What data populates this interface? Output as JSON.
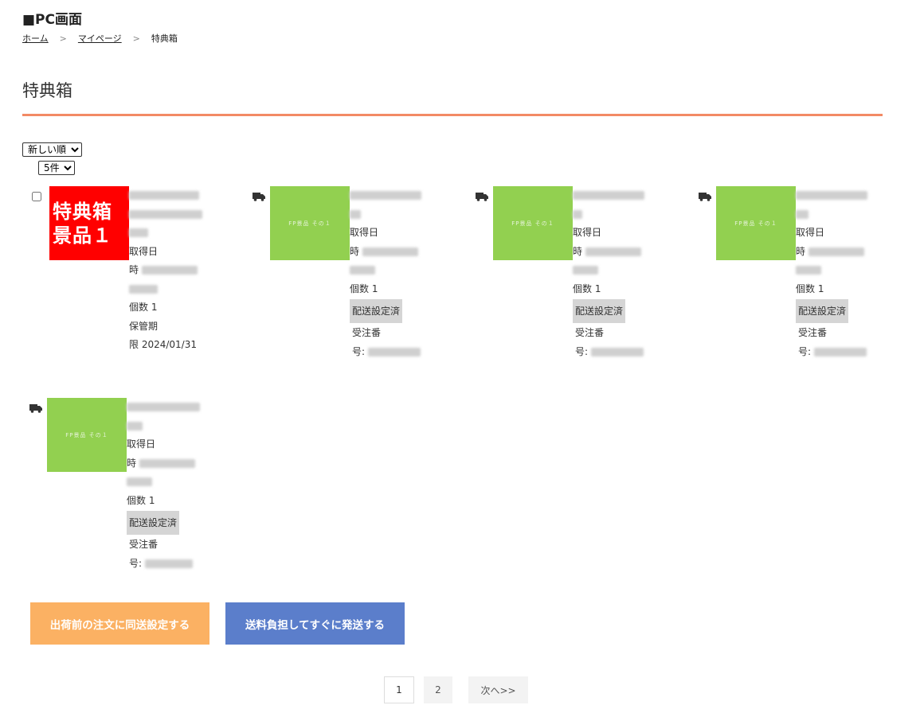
{
  "header": {
    "screen_label": "■PC画面"
  },
  "breadcrumb": {
    "home": "ホーム",
    "mypage": "マイページ",
    "current": "特典箱",
    "separator": ">"
  },
  "page": {
    "title": "特典箱"
  },
  "controls": {
    "sort_selected": "新しい順",
    "count_selected": "5件"
  },
  "items": [
    {
      "thumb_line1": "特典箱",
      "thumb_line2": "景品１",
      "date_label_a": "取得日",
      "date_label_b": "時",
      "qty": "個数 1",
      "storage_label": "保管期",
      "storage_value": "限 2024/01/31"
    },
    {
      "thumb_text": "FP景品 その１",
      "date_label_a": "取得日",
      "date_label_b": "時",
      "qty": "個数 1",
      "status": "配送設定済",
      "order_label_a": "受注番",
      "order_label_b": "号:"
    },
    {
      "thumb_text": "FP景品 その１",
      "date_label_a": "取得日",
      "date_label_b": "時",
      "qty": "個数 1",
      "status": "配送設定済",
      "order_label_a": "受注番",
      "order_label_b": "号:"
    },
    {
      "thumb_text": "FP景品 その１",
      "date_label_a": "取得日",
      "date_label_b": "時",
      "qty": "個数 1",
      "status": "配送設定済",
      "order_label_a": "受注番",
      "order_label_b": "号:"
    },
    {
      "thumb_text": "FP景品 その１",
      "date_label_a": "取得日",
      "date_label_b": "時",
      "qty": "個数 1",
      "status": "配送設定済",
      "order_label_a": "受注番",
      "order_label_b": "号:"
    }
  ],
  "actions": {
    "bundle_label": "出荷前の注文に同送設定する",
    "ship_label": "送料負担してすぐに発送する"
  },
  "pagination": {
    "page1": "1",
    "page2": "2",
    "next": "次へ>>"
  },
  "colors": {
    "accent_rule": "#f28a65",
    "thumb_green": "#92d050",
    "thumb_red": "#ff0000",
    "button_orange": "#fbb163",
    "button_blue": "#5b7ecb"
  },
  "icons": {
    "shipping": "truck-icon"
  }
}
